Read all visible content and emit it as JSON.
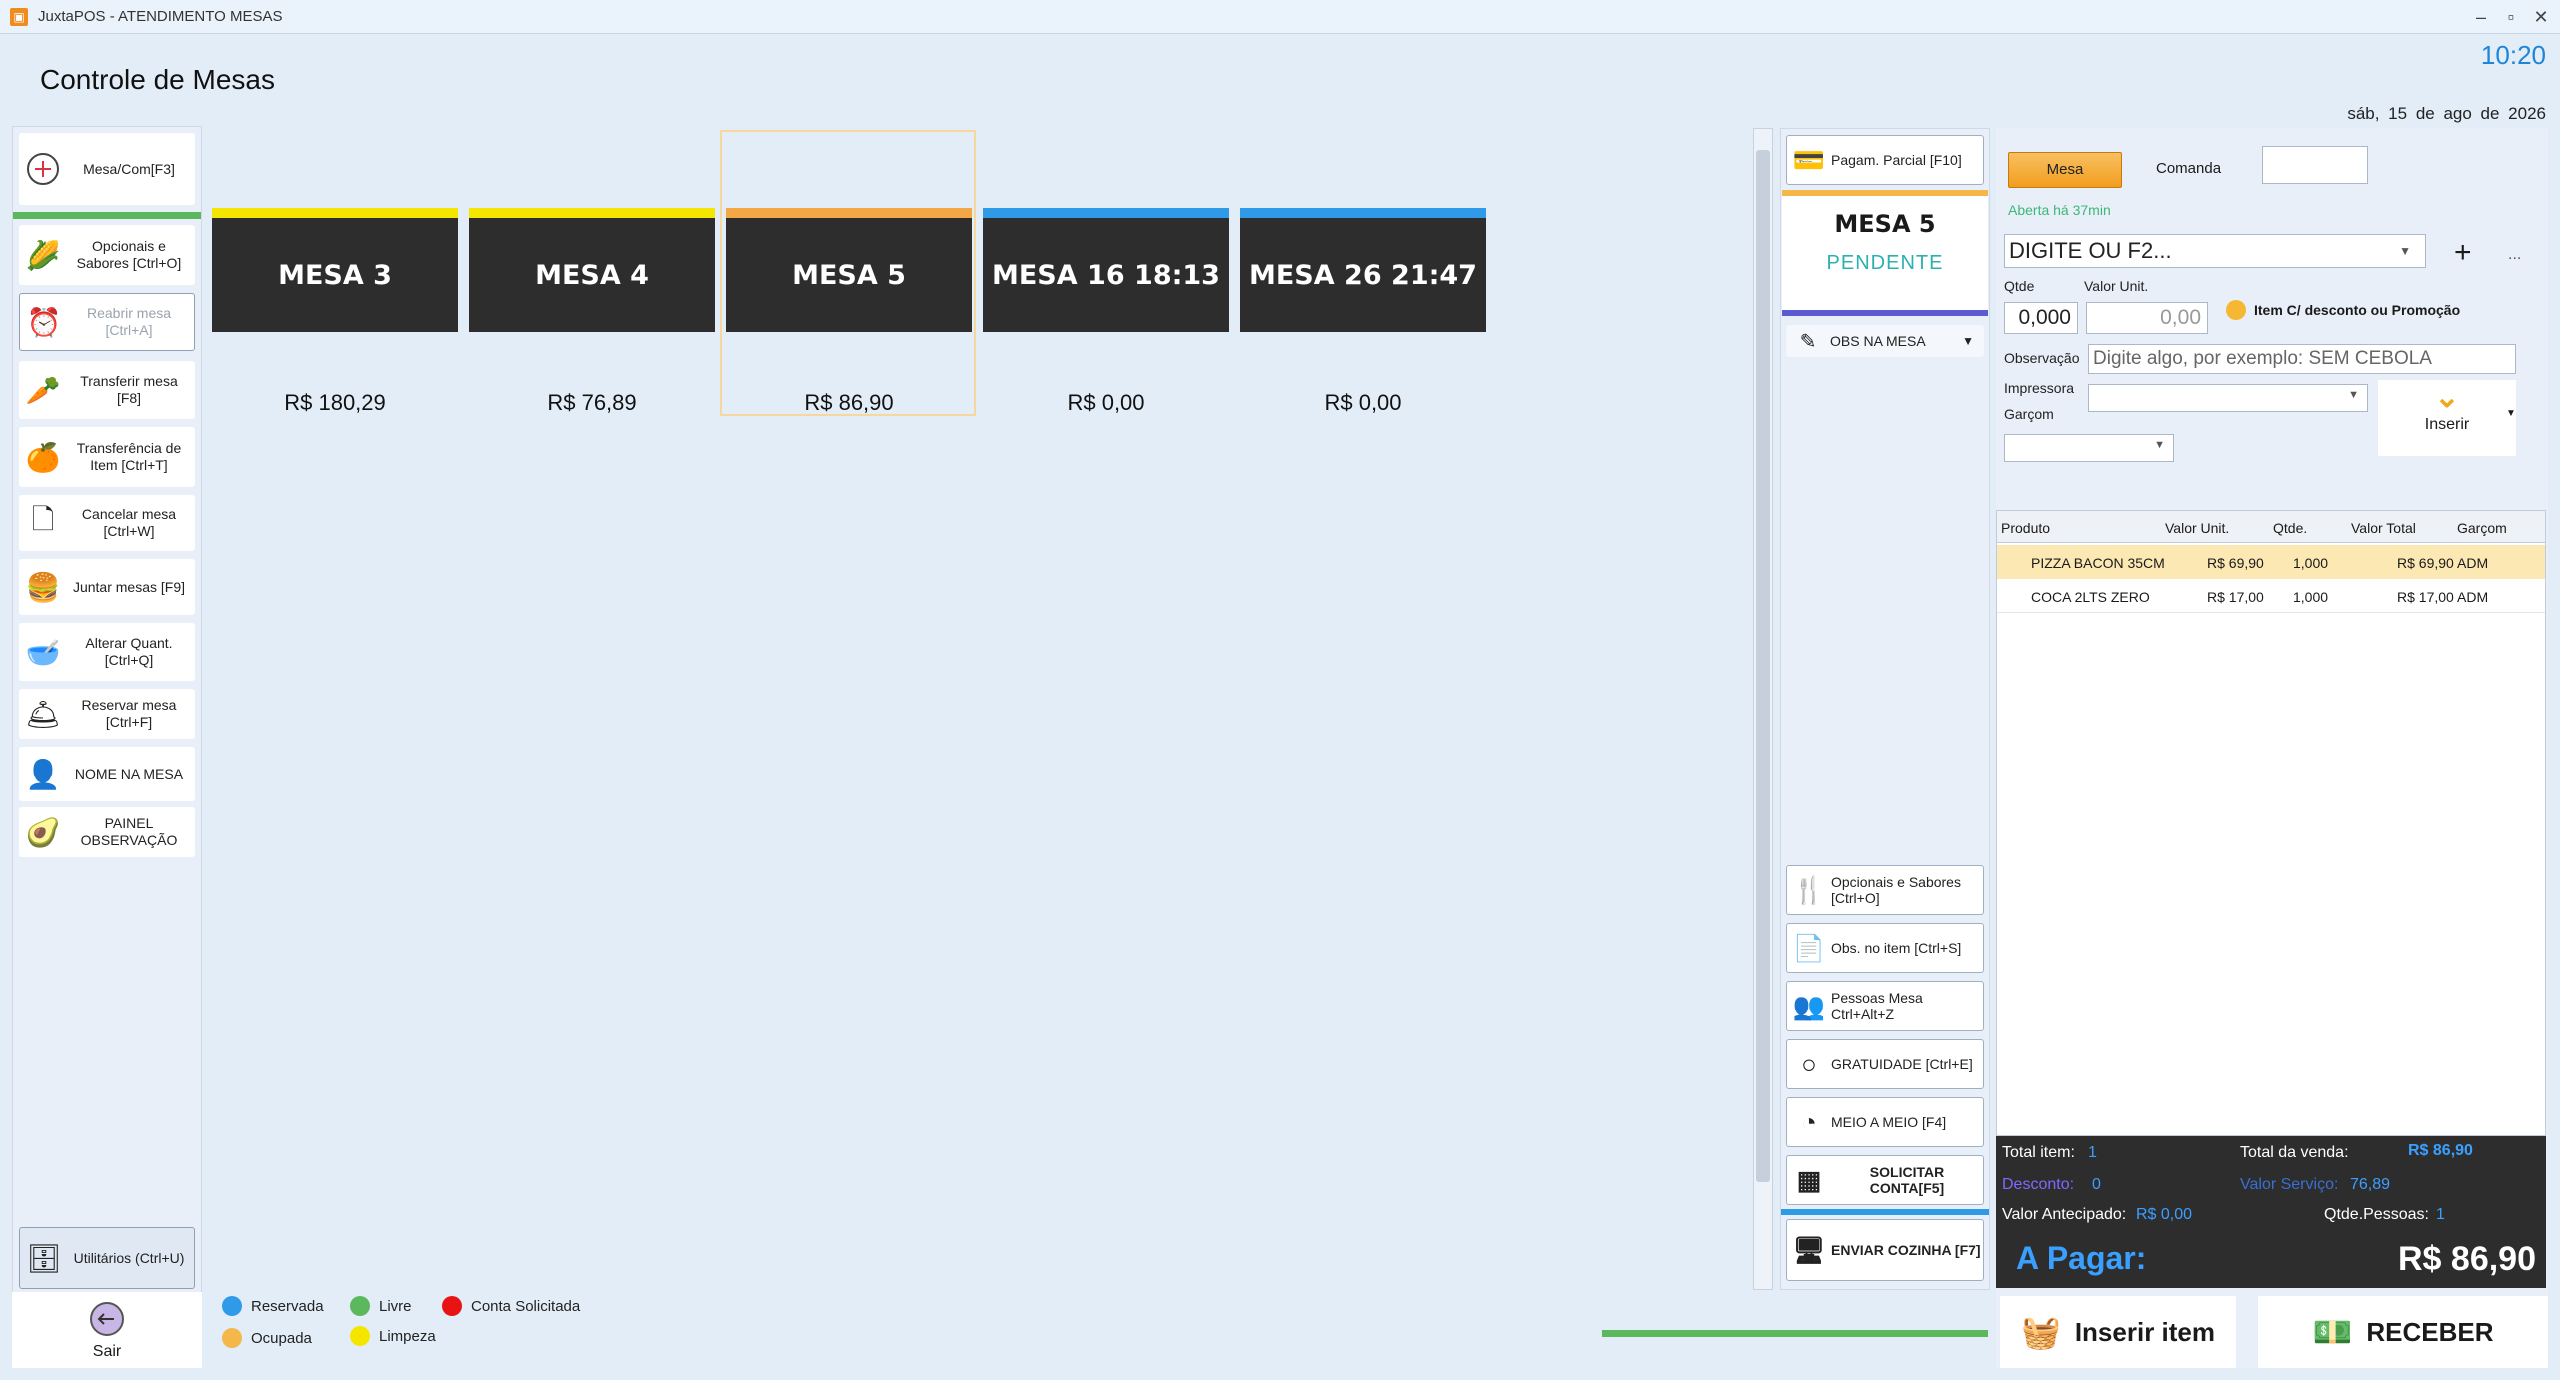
{
  "window": {
    "title": "JuxtaPOS - ATENDIMENTO MESAS"
  },
  "header": {
    "page_title": "Controle de Mesas",
    "clock": "10:20",
    "date": "sáb, 15 de ago de 2026"
  },
  "left_menu": {
    "items": [
      {
        "label": "Mesa/Com[F3]",
        "icon": "plus-circle-icon"
      },
      {
        "label": "Opcionais e Sabores [Ctrl+O]",
        "icon": "corn-icon"
      },
      {
        "label": "Reabrir mesa [Ctrl+A]",
        "icon": "alarm-clock-icon"
      },
      {
        "label": "Transferir mesa [F8]",
        "icon": "carrot-icon"
      },
      {
        "label": "Transferência de Item [Ctrl+T]",
        "icon": "orange-icon"
      },
      {
        "label": "Cancelar mesa [Ctrl+W]",
        "icon": "cancel-document-icon"
      },
      {
        "label": "Juntar mesas [F9]",
        "icon": "burger-icon"
      },
      {
        "label": "Alterar Quant. [Ctrl+Q]",
        "icon": "bowl-icon"
      },
      {
        "label": "Reservar mesa [Ctrl+F]",
        "icon": "waiter-icon"
      },
      {
        "label": "NOME NA MESA",
        "icon": "user-add-icon"
      },
      {
        "label": "PAINEL OBSERVAÇÃO",
        "icon": "avocado-icon"
      },
      {
        "label": "Utilitários (Ctrl+U)",
        "icon": "server-icon"
      }
    ],
    "exit_label": "Sair"
  },
  "tables": [
    {
      "name": "MESA 3",
      "value": "R$ 180,29",
      "status_color": "#f5e600"
    },
    {
      "name": "MESA 4",
      "value": "R$ 76,89",
      "status_color": "#f5e600"
    },
    {
      "name": "MESA 5",
      "value": "R$ 86,90",
      "status_color": "#f3a845"
    },
    {
      "name": "MESA 16 18:13",
      "value": "R$ 0,00",
      "status_color": "#2f9be8"
    },
    {
      "name": "MESA 26 21:47",
      "value": "R$ 0,00",
      "status_color": "#2f9be8"
    }
  ],
  "legend": [
    {
      "label": "Reservada",
      "color": "#2f9be8"
    },
    {
      "label": "Livre",
      "color": "#5cb85c"
    },
    {
      "label": "Conta Solicitada",
      "color": "#e81414"
    },
    {
      "label": "Ocupada",
      "color": "#f3b74a"
    },
    {
      "label": "Limpeza",
      "color": "#f5e600"
    }
  ],
  "mid_panel": {
    "pagam_parcial": "Pagam. Parcial [F10]",
    "mesa_title": "MESA 5",
    "mesa_status": "PENDENTE",
    "obs_mesa": "OBS NA MESA",
    "buttons": [
      {
        "label": "Opcionais e Sabores [Ctrl+O]",
        "icon": "fork-knife-icon"
      },
      {
        "label": "Obs. no item [Ctrl+S]",
        "icon": "document-icon"
      },
      {
        "label": "Pessoas Mesa Ctrl+Alt+Z",
        "icon": "people-icon"
      },
      {
        "label": "GRATUIDADE [Ctrl+E]",
        "icon": "circle-icon"
      },
      {
        "label": "MEIO A MEIO [F4]",
        "icon": "pie-icon"
      },
      {
        "label": "SOLICITAR CONTA[F5]",
        "icon": "calculator-icon"
      },
      {
        "label": "ENVIAR COZINHA [F7]",
        "icon": "monitor-icon"
      }
    ]
  },
  "order": {
    "mesa_btn": "Mesa",
    "comanda_label": "Comanda",
    "comanda_value": "",
    "aberta": "Aberta há 37min",
    "product_placeholder": "DIGITE OU F2...",
    "qtde_label": "Qtde",
    "qtde_value": "0,000",
    "valor_unit_label": "Valor Unit.",
    "valor_unit_value": "0,00",
    "promo_label": "Item C/ desconto ou Promoção",
    "obs_label": "Observação",
    "obs_placeholder": "Digite algo, por exemplo: SEM CEBOLA",
    "impressora_label": "Impressora",
    "garcom_label": "Garçom",
    "inserir_label": "Inserir",
    "plus": "+",
    "more": "..."
  },
  "grid": {
    "headers": [
      "Produto",
      "Valor Unit.",
      "Qtde.",
      "Valor Total",
      "Garçom"
    ],
    "rows": [
      [
        "PIZZA BACON 35CM",
        "R$ 69,90",
        "1,000",
        "R$ 69,90",
        "ADM"
      ],
      [
        "COCA 2LTS ZERO",
        "R$ 17,00",
        "1,000",
        "R$ 17,00",
        "ADM"
      ]
    ]
  },
  "totals": {
    "total_item_label": "Total item:",
    "total_item": "1",
    "total_venda_label": "Total da venda:",
    "total_venda": "R$ 86,90",
    "desconto_label": "Desconto:",
    "desconto": "0",
    "valor_servico_label": "Valor Serviço:",
    "valor_servico": "76,89",
    "antecipado_label": "Valor Antecipado:",
    "antecipado": "R$ 0,00",
    "pessoas_label": "Qtde.Pessoas:",
    "pessoas": "1",
    "a_pagar_label": "A Pagar:",
    "a_pagar": "R$ 86,90"
  },
  "actions": {
    "inserir_item": "Inserir item",
    "receber": "RECEBER"
  }
}
